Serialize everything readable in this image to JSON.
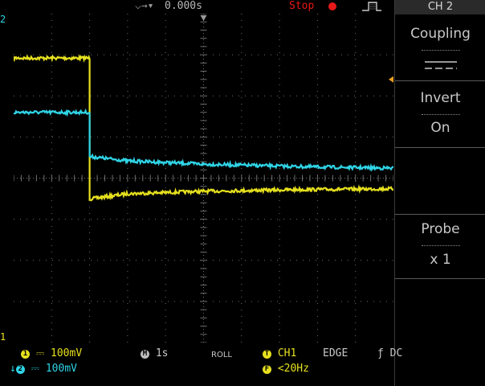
{
  "topbar": {
    "trigger_glyph": "⌵→▾",
    "time_offset": "0.000s",
    "run_status": "Stop",
    "run_status_color": "#e81818"
  },
  "markers": {
    "ch2_top": "2",
    "ch1_bottom": "1"
  },
  "side_menu": {
    "header": "CH 2",
    "coupling_label": "Coupling",
    "coupling_icon": "dc-coupling-icon",
    "invert_label": "Invert",
    "invert_value": "On",
    "probe_label": "Probe",
    "probe_value": "x 1"
  },
  "bottombar": {
    "ch1_num": "1",
    "ch1_scale": "⎓ 100mV",
    "ch2_num": "2",
    "ch2_scale": "⎓ 100mV",
    "timebase_badge": "M",
    "timebase": "1s",
    "mode": "ROLL",
    "trig_badge": "T",
    "trig_source": "CH1",
    "trig_type": "EDGE",
    "trig_coupling": "ƒ DC",
    "filter_badge": "F",
    "trig_filter": "<20Hz"
  },
  "colors": {
    "ch1": "#e6e01e",
    "ch2": "#2fd4e6",
    "grid": "#707070",
    "background": "#000000"
  },
  "chart_data": {
    "type": "line",
    "grid": true,
    "xdiv": 10,
    "ydiv": 8,
    "xlim": [
      0,
      10
    ],
    "ylim": [
      -4,
      4
    ],
    "series": [
      {
        "channel": "ch1",
        "x": [
          0,
          2.0,
          2.0,
          2.05,
          3.0,
          5.0,
          7.5,
          10.0
        ],
        "y": [
          2.92,
          2.92,
          -0.5,
          -0.5,
          -0.38,
          -0.32,
          -0.28,
          -0.26
        ]
      },
      {
        "channel": "ch2",
        "x": [
          0,
          2.0,
          2.0,
          2.05,
          3.0,
          5.0,
          7.5,
          10.0
        ],
        "y": [
          1.6,
          1.6,
          0.52,
          0.52,
          0.42,
          0.34,
          0.28,
          0.24
        ]
      }
    ],
    "trigger_level_div": 2.4
  }
}
